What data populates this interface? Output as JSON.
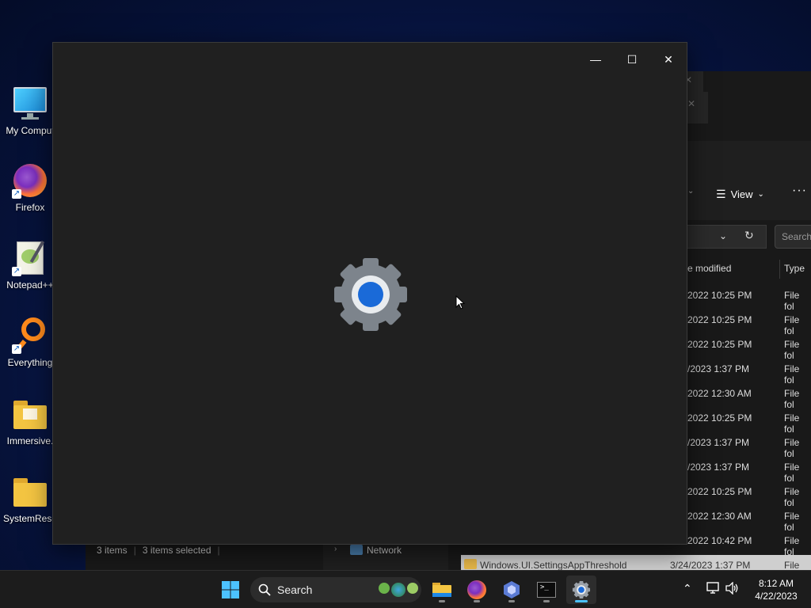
{
  "desktop": {
    "icons": [
      {
        "label": "My Comput",
        "icon": "monitor-icon"
      },
      {
        "label": "Firefox",
        "icon": "firefox-icon"
      },
      {
        "label": "Notepad++",
        "icon": "notepad-icon"
      },
      {
        "label": "Everything",
        "icon": "search-magnifier-icon"
      },
      {
        "label": "Immersive.",
        "icon": "folder-icon"
      },
      {
        "label": "SystemReso",
        "icon": "folder-icon"
      }
    ]
  },
  "explorer": {
    "toolbar": {
      "view_label": "View",
      "more_label": "···"
    },
    "search_placeholder": "Search",
    "columns": {
      "date_modified": "e modified",
      "type": "Type"
    },
    "rows": [
      {
        "date": "2022 10:25 PM",
        "type": "File fol"
      },
      {
        "date": "2022 10:25 PM",
        "type": "File fol"
      },
      {
        "date": "2022 10:25 PM",
        "type": "File fol"
      },
      {
        "date": "/2023 1:37 PM",
        "type": "File fol"
      },
      {
        "date": "2022 12:30 AM",
        "type": "File fol"
      },
      {
        "date": "2022 10:25 PM",
        "type": "File fol"
      },
      {
        "date": "/2023 1:37 PM",
        "type": "File fol"
      },
      {
        "date": "/2023 1:37 PM",
        "type": "File fol"
      },
      {
        "date": "2022 10:25 PM",
        "type": "File fol"
      },
      {
        "date": "2022 12:30 AM",
        "type": "File fol"
      },
      {
        "date": "2022 10:42 PM",
        "type": "File fol"
      }
    ],
    "selected_row": {
      "name": "Windows.UI.SettingsAppThreshold",
      "date": "3/24/2023 1:37 PM",
      "type": "File fol"
    },
    "nav_network": "Network",
    "status": {
      "items": "3 items",
      "selected": "3 items selected"
    }
  },
  "settings_window": {
    "minimize": "—",
    "maximize": "☐",
    "close": "✕"
  },
  "taskbar": {
    "search_label": "Search",
    "clock_time": "8:12 AM",
    "clock_date": "4/22/2023"
  },
  "colors": {
    "accent": "#4cc2ff",
    "gear_blue": "#1a6ad8",
    "gear_gray": "#7d848c"
  }
}
